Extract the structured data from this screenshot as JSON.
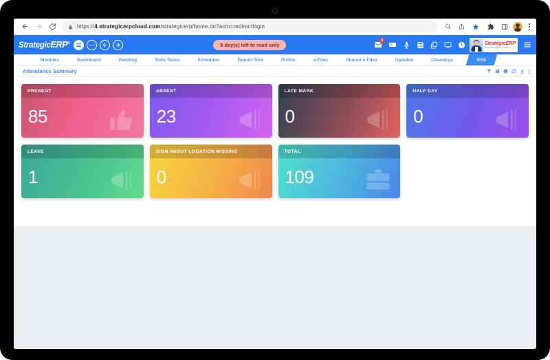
{
  "browser": {
    "url_prefix": "https://",
    "url_bold": "4.strategicerpcloud.com",
    "url_rest": "/strategicerp/home.do?actn=redirectlogin",
    "back_label": "Back",
    "forward_label": "Forward",
    "reload_label": "Reload",
    "lock_label": "site-information",
    "icons": {
      "zoom": "search-zoom-icon",
      "share": "share-icon",
      "bookmark": "star-bookmark-icon",
      "extensions": "puzzle-extensions-icon",
      "sidepanel": "side-panel-icon",
      "profile": "chrome-profile-avatar",
      "menu": "chrome-three-dot-menu"
    }
  },
  "app_header": {
    "logo_text": "StrategicERP",
    "logo_strategic": "Strategic",
    "logo_erp": "ERP",
    "logo_registered": "®",
    "trial_badge": "9 day(s) left to read only",
    "mail_badge_count": "0",
    "icons": [
      "mail-icon",
      "id-card-icon",
      "microphone-icon",
      "calculator-icon",
      "windows-copy-icon",
      "monitor-icon",
      "globe-clock-icon"
    ],
    "user": {
      "company_logo": "StrategicERP",
      "company_tagline": "Real Estate ERP Software",
      "avatar": "user-avatar-photo"
    },
    "burger_label": "main-menu"
  },
  "nav": {
    "items": [
      {
        "label": "Modules",
        "active": false
      },
      {
        "label": "Dashboard",
        "active": false
      },
      {
        "label": "Pending",
        "active": false
      },
      {
        "label": "Todo Tasks",
        "active": false
      },
      {
        "label": "Scheduler",
        "active": false
      },
      {
        "label": "Report Tool",
        "active": false
      },
      {
        "label": "Profile",
        "active": false
      },
      {
        "label": "e-Files",
        "active": false
      },
      {
        "label": "Shared e-Files",
        "active": false
      },
      {
        "label": "Updates",
        "active": false
      },
      {
        "label": "Chanakya",
        "active": false
      },
      {
        "label": "ESS",
        "active": true
      }
    ]
  },
  "page": {
    "title": "Attendance Summary",
    "actions": [
      "filter-icon",
      "grid-view-icon",
      "info-icon",
      "refresh-icon",
      "download-icon",
      "more-vertical-icon"
    ]
  },
  "cards": [
    {
      "label": "PRESENT",
      "value": "85",
      "icon": "thumbs-up-icon",
      "color_from": "#c0576b",
      "color_to": "#f0628f"
    },
    {
      "label": "ABSENT",
      "value": "23",
      "icon": "megaphone-icon",
      "color_from": "#7b5bec",
      "color_to": "#d661ef"
    },
    {
      "label": "LATE MARK",
      "value": "0",
      "icon": "megaphone-icon",
      "color_from": "#3c4a5c",
      "color_to": "#e0615c"
    },
    {
      "label": "HALF DAY",
      "value": "0",
      "icon": "megaphone-icon",
      "color_from": "#4a7ae8",
      "color_to": "#9a4fe8"
    },
    {
      "label": "LEAVE",
      "value": "1",
      "icon": "megaphone-icon",
      "color_from": "#3aa898",
      "color_to": "#5ddb8c"
    },
    {
      "label": "SIGN IN/OUT LOCATION MISSING",
      "value": "0",
      "icon": "megaphone-icon",
      "color_from": "#f6cf3f",
      "color_to": "#f08a4b"
    },
    {
      "label": "TOTAL",
      "value": "109",
      "icon": "briefcase-icon",
      "color_from": "#4fe0c8",
      "color_to": "#4a86e8"
    }
  ]
}
